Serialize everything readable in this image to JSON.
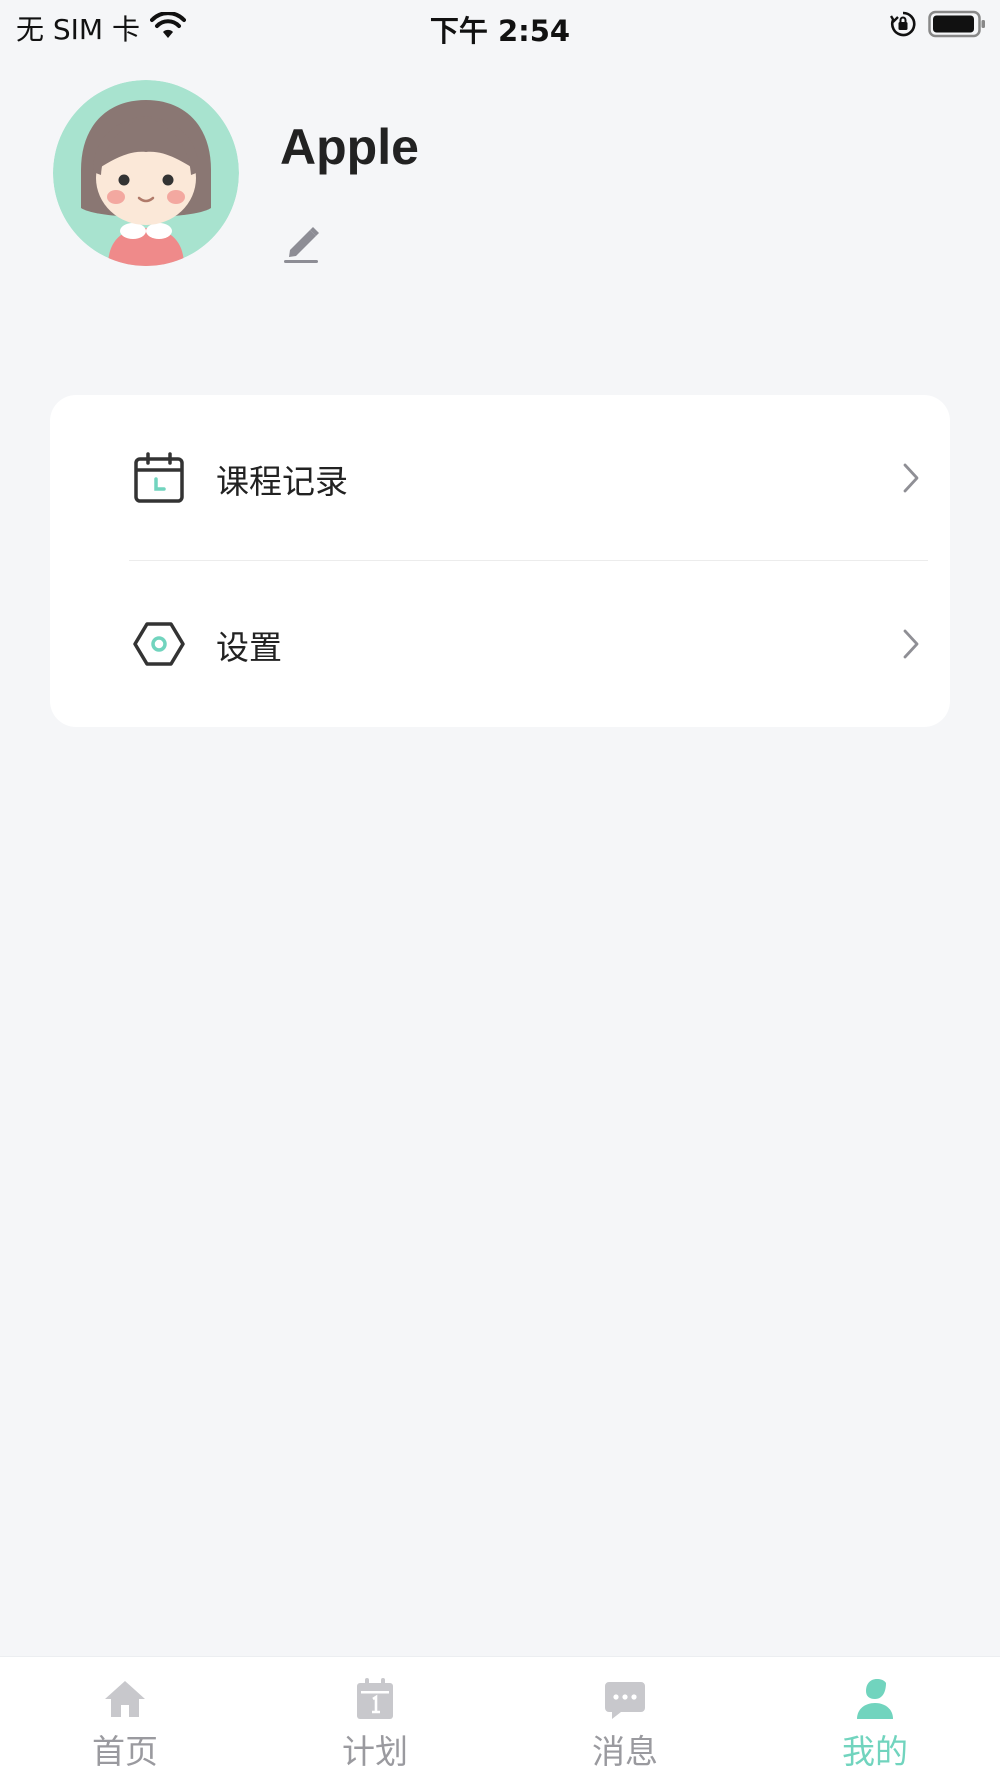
{
  "status_bar": {
    "carrier": "无 SIM 卡",
    "time": "下午 2:54"
  },
  "profile": {
    "name": "Apple"
  },
  "menu": {
    "items": [
      {
        "label": "课程记录",
        "icon": "calendar-icon"
      },
      {
        "label": "设置",
        "icon": "settings-hexagon-icon"
      }
    ]
  },
  "tab_bar": {
    "tabs": [
      {
        "label": "首页",
        "icon": "home-icon",
        "active": false
      },
      {
        "label": "计划",
        "icon": "calendar-plan-icon",
        "active": false
      },
      {
        "label": "消息",
        "icon": "message-icon",
        "active": false
      },
      {
        "label": "我的",
        "icon": "profile-icon",
        "active": true
      }
    ]
  },
  "colors": {
    "accent": "#71d4be",
    "background": "#f5f6f8",
    "inactive": "#9a9a9f",
    "avatar_ring": "#a8e3cf"
  }
}
